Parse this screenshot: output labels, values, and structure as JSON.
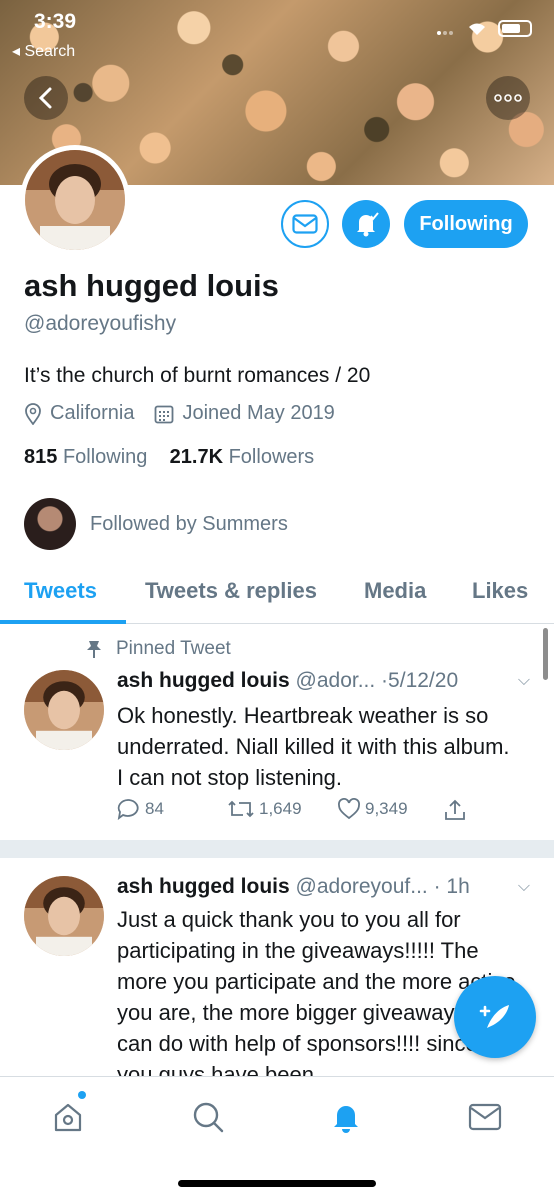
{
  "status_bar": {
    "time": "3:39",
    "back_label": "◂ Search"
  },
  "profile": {
    "name": "ash hugged louis",
    "handle": "@adoreyoufishy",
    "bio": "It’s the church of burnt romances / 20",
    "location": "California",
    "joined": "Joined May 2019",
    "following_count": "815",
    "following_label": "Following",
    "followers_count": "21.7K",
    "followers_label": "Followers",
    "followed_by": "Followed by Summers",
    "following_button": "Following"
  },
  "tabs": [
    {
      "label": "Tweets",
      "active": true
    },
    {
      "label": "Tweets & replies",
      "active": false
    },
    {
      "label": "Media",
      "active": false
    },
    {
      "label": "Likes",
      "active": false
    }
  ],
  "tweets": [
    {
      "pinned_label": "Pinned Tweet",
      "name": "ash hugged louis",
      "handle_time": "@ador... ·5/12/20",
      "text": "Ok honestly. Heartbreak weather is so underrated. Niall killed it with this album. I can not stop listening.",
      "replies": "84",
      "retweets": "1,649",
      "likes": "9,349"
    },
    {
      "name": "ash hugged louis",
      "handle_time": "@adoreyouf... · 1h",
      "text": "Just a quick thank you to you all for participating in the giveaways!!!!! The more you participate and the more active you are, the more bigger giveaways I can do with help of sponsors!!!! since you guys have been"
    }
  ],
  "colors": {
    "accent": "#1da1f2",
    "secondary_text": "#657786"
  }
}
